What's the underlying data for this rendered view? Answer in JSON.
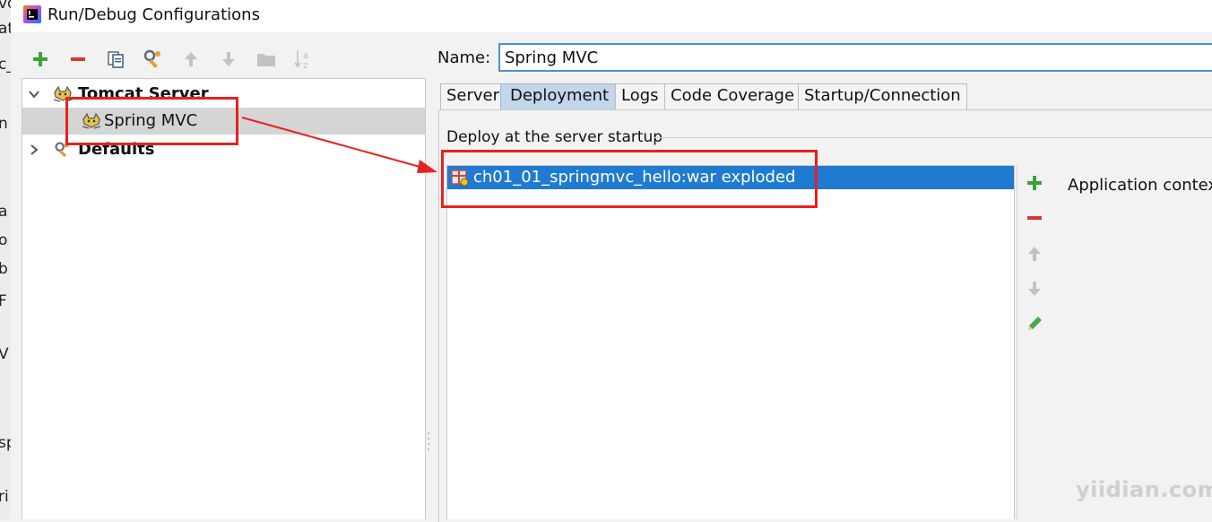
{
  "window": {
    "title": "Run/Debug Configurations"
  },
  "behind_fragments": [
    "vo",
    "at",
    "c_",
    "n",
    "a",
    "o",
    "b",
    "F",
    "V",
    "sp",
    "ri"
  ],
  "toolbar": {
    "add_icon": "plus-icon",
    "remove_icon": "minus-icon",
    "copy_icon": "copy-icon",
    "edit_defaults_icon": "wrench-icon",
    "move_up_icon": "arrow-up-icon",
    "move_down_icon": "arrow-down-icon",
    "folder_icon": "folder-icon",
    "sort_icon": "sort-az-icon",
    "sort_label_a": "a",
    "sort_label_z": "z"
  },
  "tree": {
    "groups": [
      {
        "label": "Tomcat Server",
        "expanded": true,
        "children": [
          {
            "label": "Spring MVC",
            "selected": true
          }
        ]
      },
      {
        "label": "Defaults",
        "expanded": false
      }
    ]
  },
  "config": {
    "name_label": "Name:",
    "name_value": "Spring MVC",
    "tabs": [
      {
        "label": "Server",
        "active": false
      },
      {
        "label": "Deployment",
        "active": true
      },
      {
        "label": "Logs",
        "active": false
      },
      {
        "label": "Code Coverage",
        "active": false
      },
      {
        "label": "Startup/Connection",
        "active": false
      }
    ],
    "deploy_group_title": "Deploy at the server startup",
    "artifacts": [
      {
        "label": "ch01_01_springmvc_hello:war exploded",
        "selected": true
      }
    ],
    "application_context_label": "Application contex"
  },
  "colors": {
    "selection": "#1f7bd1",
    "annotation_red": "#e8211f",
    "add_green": "#3aa33a",
    "remove_red": "#d9362b"
  },
  "watermark": "yiidian.com"
}
